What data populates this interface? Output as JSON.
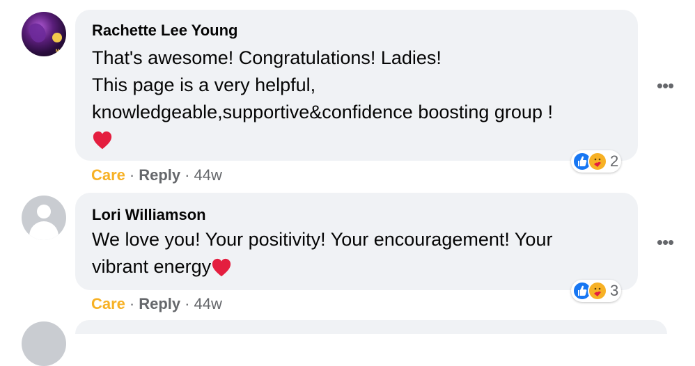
{
  "comments": [
    {
      "author": "Rachette Lee Young",
      "avatar_label": "May 31",
      "text": "That's awesome! Congratulations! Ladies!\nThis page is a very helpful,\nknowledgeable,supportive&confidence boosting group !",
      "emoji": "heart",
      "reactions": [
        "like",
        "care"
      ],
      "reaction_count": "2",
      "actions": {
        "care": "Care",
        "reply": "Reply",
        "time": "44w"
      },
      "more": "•••"
    },
    {
      "author": "Lori Williamson",
      "text": "We love you! Your positivity! Your encouragement! Your\nvibrant energy",
      "emoji": "heart",
      "reactions": [
        "like",
        "care"
      ],
      "reaction_count": "3",
      "actions": {
        "care": "Care",
        "reply": "Reply",
        "time": "44w"
      },
      "more": "•••"
    }
  ],
  "separator": "·",
  "colors": {
    "bubble": "#f0f2f5",
    "care": "#f7b125",
    "like": "#1877f2",
    "meta": "#65676b",
    "heart": "#e41e3f"
  }
}
